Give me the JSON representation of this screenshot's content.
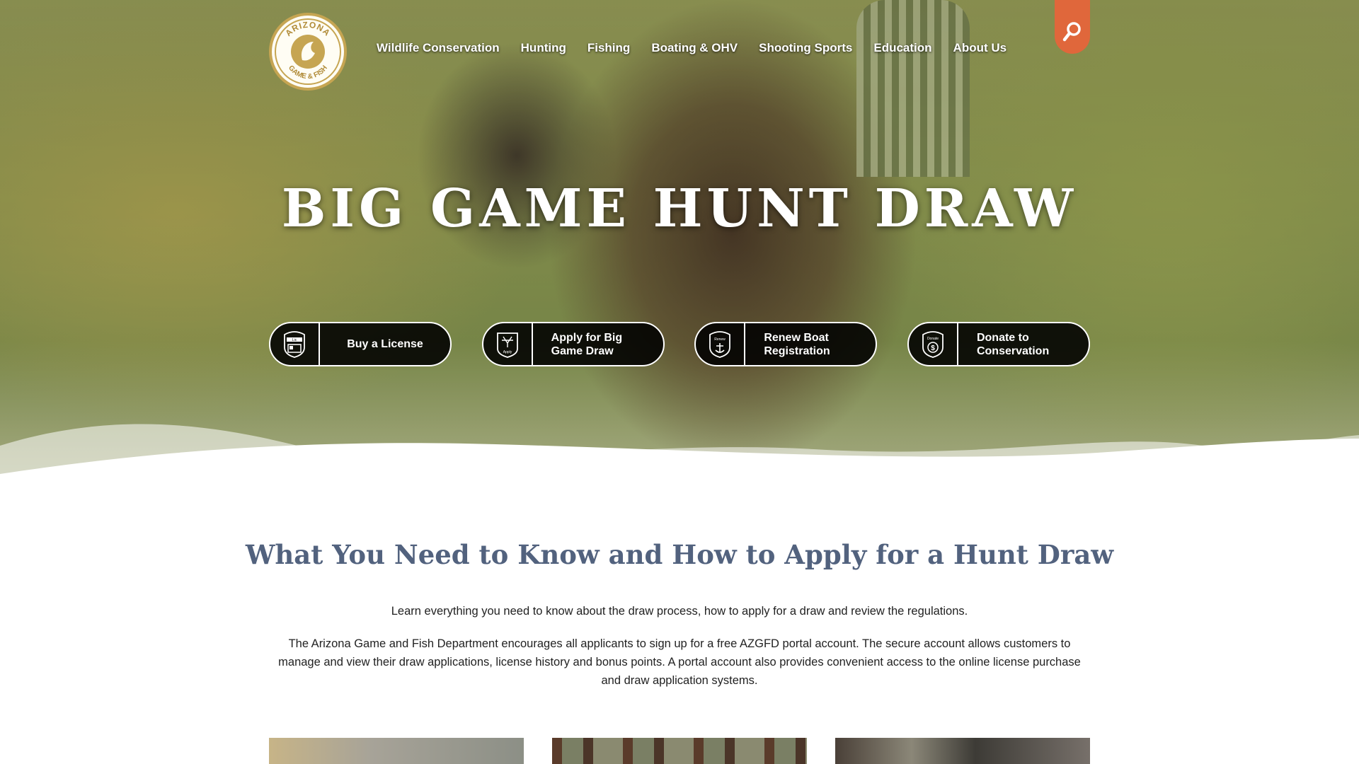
{
  "header": {
    "logo_alt": "Arizona Game & Fish",
    "logo_text": {
      "line1": "ARIZONA",
      "line2": "GAME & FISH"
    },
    "nav": [
      {
        "label": "Wildlife Conservation"
      },
      {
        "label": "Hunting"
      },
      {
        "label": "Fishing"
      },
      {
        "label": "Boating & OHV"
      },
      {
        "label": "Shooting Sports"
      },
      {
        "label": "Education"
      },
      {
        "label": "About Us"
      }
    ],
    "search_icon": "search-icon",
    "search_color": "#e0673b"
  },
  "hero": {
    "title": "BIG GAME HUNT DRAW",
    "actions": [
      {
        "label": "Buy a License",
        "icon": "license-badge-icon",
        "badge_text": "Lic"
      },
      {
        "label_line1": "Apply for Big",
        "label_line2": "Game Draw",
        "icon": "apply-badge-icon",
        "badge_text": "Apply"
      },
      {
        "label_line1": "Renew Boat",
        "label_line2": "Registration",
        "icon": "renew-badge-icon",
        "badge_text": "Renew"
      },
      {
        "label_line1": "Donate to",
        "label_line2": "Conservation",
        "icon": "donate-badge-icon",
        "badge_text": "Donate"
      }
    ]
  },
  "content": {
    "title": "What You Need to Know and How to Apply for a Hunt Draw",
    "intro": "Learn everything you need to know about the draw process, how to apply for a draw and review the regulations.",
    "body": "The Arizona Game and Fish Department encourages all applicants to sign up for a free AZGFD portal account. The secure account allows customers to manage and view their draw applications, license history and bonus points. A portal account also provides convenient access to the online license purchase and draw application systems.",
    "title_color": "#52627e"
  },
  "cards": [
    {
      "name": "card-1"
    },
    {
      "name": "card-2"
    },
    {
      "name": "card-3"
    }
  ]
}
